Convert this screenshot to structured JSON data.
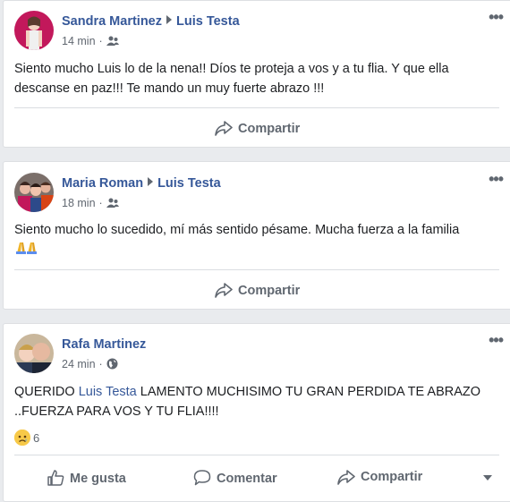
{
  "posts": [
    {
      "author": "Sandra Martinez",
      "target": "Luis Testa",
      "time": "14 min",
      "privacy_icon": "friends-icon",
      "text": "Siento mucho Luis lo de la nena!! Díos te proteja a vos y a tu flia. Y que ella descanse en paz!!! Te mando un muy fuerte abrazo !!!",
      "share_label": "Compartir"
    },
    {
      "author": "Maria Roman",
      "target": "Luis Testa",
      "time": "18 min",
      "privacy_icon": "friends-icon",
      "text": "Siento mucho lo sucedido, mí más sentido pésame. Mucha fuerza a la familia",
      "emoji": "folded-hands-icon",
      "share_label": "Compartir"
    },
    {
      "author": "Rafa Martinez",
      "time": "24 min",
      "privacy_icon": "globe-icon",
      "text_prefix": "QUERIDO ",
      "mention": "Luis Testa",
      "text_suffix": " LAMENTO MUCHISIMO TU GRAN PERDIDA TE ABRAZO ..FUERZA PARA VOS Y TU FLIA!!!!",
      "reaction_icon": "sad-reaction-icon",
      "reaction_count": "6",
      "like_label": "Me gusta",
      "comment_label": "Comentar",
      "share_label": "Compartir"
    }
  ],
  "more_glyph": "•••",
  "colors": {
    "link": "#365899",
    "meta": "#606770",
    "background": "#e9ebee"
  }
}
